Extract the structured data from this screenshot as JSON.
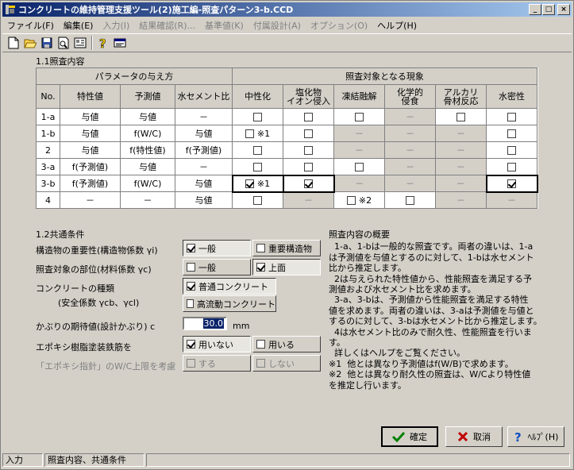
{
  "window": {
    "title": "コンクリートの維持管理支援ツール(2)施工編-照査パターン3-b.CCD"
  },
  "menu": [
    {
      "label": "ファイル(F)",
      "enabled": true
    },
    {
      "label": "編集(E)",
      "enabled": true
    },
    {
      "label": "入力(I)",
      "enabled": false
    },
    {
      "label": "結果確認(R)...",
      "enabled": false
    },
    {
      "label": "基準値(K)",
      "enabled": false
    },
    {
      "label": "付属設計(A)",
      "enabled": false
    },
    {
      "label": "オプション(O)",
      "enabled": false
    },
    {
      "label": "ヘルプ(H)",
      "enabled": true
    }
  ],
  "section1": {
    "title": "1.1照査内容"
  },
  "grid": {
    "header_params": "パラメータの与え方",
    "header_phen": "照査対象となる現象",
    "col_no": "No.",
    "col_char": "特性値",
    "col_pred": "予測値",
    "col_wc": "水セメント比",
    "phen_cols": [
      "中性化",
      "塩化物\nイオン侵入",
      "凍結融解",
      "化学的\n侵食",
      "アルカリ\n骨材反応",
      "水密性"
    ],
    "rows": [
      {
        "no": "1-a",
        "char": "与値",
        "pred": "与値",
        "wc": "－",
        "cells": [
          "cb",
          "cb",
          "cb",
          "dash",
          "cb",
          "cb"
        ]
      },
      {
        "no": "1-b",
        "char": "与値",
        "pred": "f(W/C)",
        "wc": "与値",
        "cells": [
          "cb:※1",
          "cb",
          "dash",
          "dash",
          "dash",
          "cb"
        ]
      },
      {
        "no": "2",
        "char": "与値",
        "pred": "f(特性値)",
        "wc": "f(予測値)",
        "cells": [
          "cb",
          "cb",
          "dash",
          "dash",
          "dash",
          "cb"
        ]
      },
      {
        "no": "3-a",
        "char": "f(予測値)",
        "pred": "与値",
        "wc": "－",
        "cells": [
          "cb",
          "cb",
          "cb",
          "dash",
          "dash",
          "cb"
        ]
      },
      {
        "no": "3-b",
        "char": "f(予測値)",
        "pred": "f(W/C)",
        "wc": "与値",
        "cells": [
          "on:※1",
          "on",
          "dash",
          "dash",
          "dash",
          "on"
        ],
        "selected": true
      },
      {
        "no": "4",
        "char": "－",
        "pred": "－",
        "wc": "与値",
        "cells": [
          "cb",
          "dash",
          "cb:※2",
          "cb",
          "dash",
          "dash"
        ]
      }
    ]
  },
  "section2": {
    "title": "1.2共通条件",
    "importance_label": "構造物の重要性(構造物係数 γi)",
    "importance_opts": [
      "一般",
      "重要構造物"
    ],
    "part_label": "照査対象の部位(材料係数 γc)",
    "part_opts": [
      "一般",
      "上面"
    ],
    "conc_label": "コンクリートの種類",
    "conc_sublabel": "(安全係数 γcb、γcl)",
    "conc_opts": [
      "普通コンクリート",
      "高流動コンクリート"
    ],
    "cover_label": "かぶりの期待値(設計かぶり) c",
    "cover_value": "30.0",
    "cover_unit": "mm",
    "epoxy_label": "エポキシ樹脂塗装鉄筋を",
    "epoxy_opts": [
      "用いない",
      "用いる"
    ],
    "wc_label": "「エポキシ指針」のW/C上限を考慮",
    "wc_opts": [
      "する",
      "しない"
    ]
  },
  "summary": {
    "title": "照査内容の概要",
    "lines": [
      "  1-a、1-bは一般的な照査です。両者の違いは、1-a",
      "は予測値を与値とするのに対して、1-bは水セメント",
      "比から推定します。",
      "  2は与えられた特性値から、性能照査を満足する予",
      "測値および水セメント比を求めます。",
      "  3-a、3-bは、予測値から性能照査を満足する特性",
      "値を求めます。両者の違いは、3-aは予測値を与値と",
      "するのに対して、3-bは水セメント比から推定します。",
      "  4は水セメント比のみで耐久性、性能照査を行いま",
      "す。",
      "  詳しくはヘルプをご覧ください。",
      "※1  他とは異なり予測値はf(W/B)で求めます。",
      "※2  他とは異なり耐久性の照査は、W/Cより特性値",
      "を推定し行います。"
    ]
  },
  "buttons": {
    "ok": "確定",
    "cancel": "取消",
    "help": "ﾍﾙﾌﾟ(H)"
  },
  "status": {
    "mode": "入力",
    "detail": "照査内容、共通条件"
  }
}
